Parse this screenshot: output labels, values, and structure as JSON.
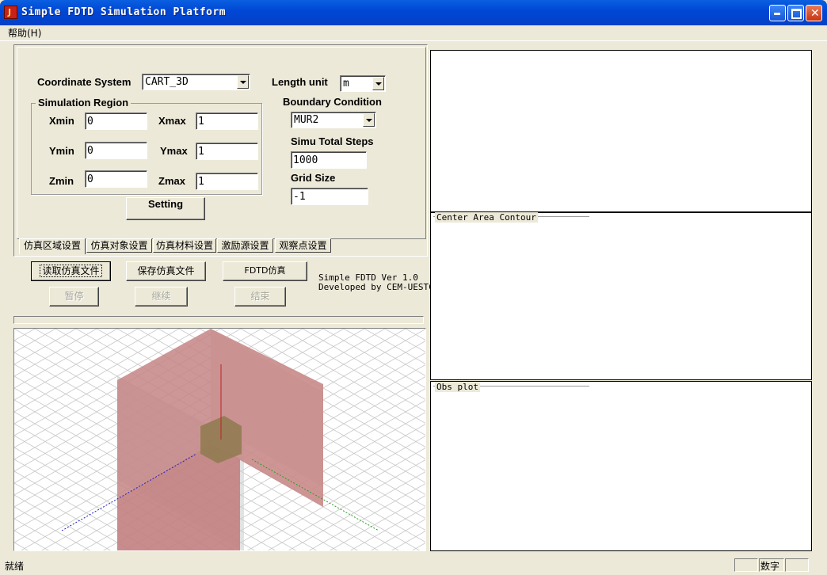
{
  "window": {
    "title": "Simple FDTD Simulation Platform",
    "icon": "app-j-icon",
    "controls": [
      "minimize-icon",
      "maximize-icon",
      "close-icon"
    ]
  },
  "menu": {
    "help": "帮助(H)"
  },
  "settings": {
    "coord_label": "Coordinate  System",
    "coord_value": "CART_3D",
    "length_label": "Length unit",
    "length_value": "m",
    "region_label": "Simulation Region",
    "xmin_label": "Xmin",
    "xmin": "0",
    "xmax_label": "Xmax",
    "xmax": "1",
    "ymin_label": "Ymin",
    "ymin": "0",
    "ymax_label": "Ymax",
    "ymax": "1",
    "zmin_label": "Zmin",
    "zmin": "0",
    "zmax_label": "Zmax",
    "zmax": "1",
    "boundary_label": "Boundary Condition",
    "boundary_value": "MUR2",
    "steps_label": "Simu Total Steps",
    "steps_value": "1000",
    "grid_label": "Grid Size",
    "grid_value": "-1",
    "setting_button": "Setting"
  },
  "tabs": [
    "仿真区域设置",
    "仿真对象设置",
    "仿真材料设置",
    "激励源设置",
    "观察点设置"
  ],
  "actions": {
    "read": "读取仿真文件",
    "save": "保存仿真文件",
    "fdtd": "FDTD仿真",
    "pause": "暂停",
    "continue": "继续",
    "stop": "结束"
  },
  "version": {
    "line1": "Simple FDTD Ver 1.0",
    "line2": "Developed by CEM-UESTC"
  },
  "plots": {
    "center": "Center Area Contour",
    "obs": "Obs plot"
  },
  "status": {
    "ready": "就绪",
    "num": "数字"
  },
  "colors": {
    "titlebar": "#0A5FE0",
    "plane": "#C98A8A",
    "object": "#8E7A4E"
  }
}
